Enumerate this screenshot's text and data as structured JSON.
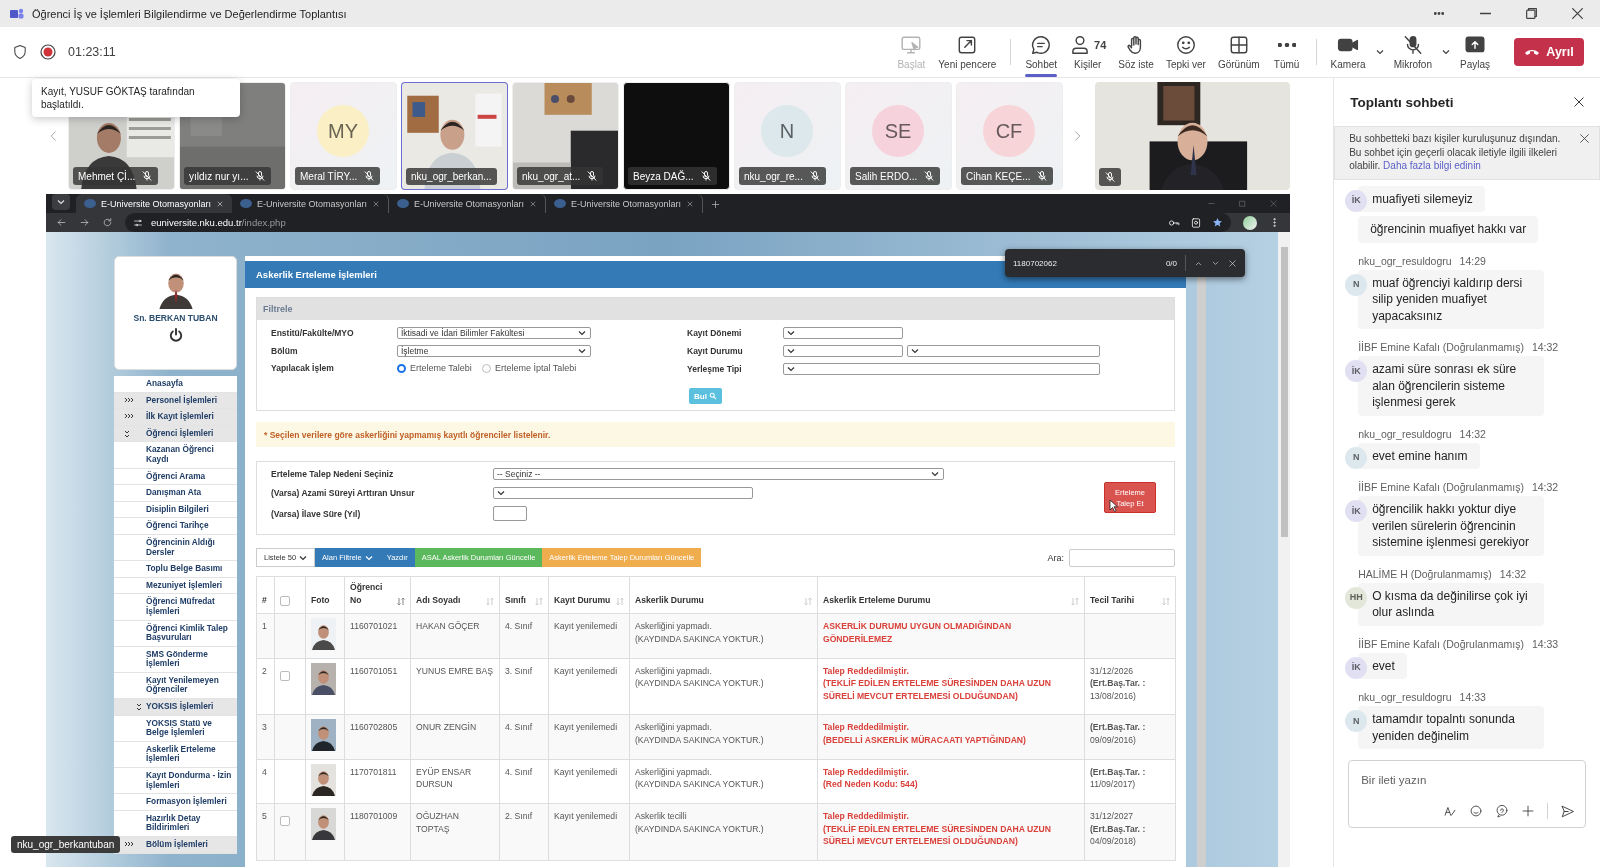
{
  "window": {
    "title": "Öğrenci İş ve İşlemleri Bilgilendirme ve Değerlendirme Toplantısı"
  },
  "meeting": {
    "recording": true,
    "timer": "01:23:11",
    "tooltip": "Kayıt, YUSUF GÖKTAŞ tarafından başlatıldı."
  },
  "toolbar": [
    {
      "label": "Başlat",
      "kind": "tray",
      "disabled": true,
      "selected": false
    },
    {
      "label": "Yeni pencere",
      "kind": "popout",
      "disabled": false,
      "selected": false
    },
    {
      "label": "Sohbet",
      "kind": "chat",
      "disabled": false,
      "selected": true
    },
    {
      "label": "Kişiler",
      "kind": "people",
      "count": "74",
      "disabled": false,
      "selected": false
    },
    {
      "label": "Söz iste",
      "kind": "hand",
      "disabled": false,
      "selected": false
    },
    {
      "label": "Tepki ver",
      "kind": "react",
      "disabled": false,
      "selected": false
    },
    {
      "label": "Görünüm",
      "kind": "view",
      "disabled": false,
      "selected": false
    },
    {
      "label": "Tümü",
      "kind": "more",
      "disabled": false,
      "selected": false
    },
    {
      "label": "Kamera",
      "kind": "camera",
      "disabled": false,
      "selected": false
    },
    {
      "label": "Mikrofon",
      "kind": "mic-off",
      "disabled": false,
      "selected": false
    },
    {
      "label": "Paylaş",
      "kind": "share",
      "disabled": false,
      "selected": false
    }
  ],
  "leave_button": "Ayrıl",
  "participants": [
    {
      "name": "Mehmet Çİ...",
      "kind": "video",
      "muted": true,
      "speaking": false
    },
    {
      "name": "yıldız nur yı...",
      "kind": "video",
      "muted": true,
      "speaking": false
    },
    {
      "name": "Meral TİRY...",
      "kind": "avatar",
      "initials": "MY",
      "color": "#fbefc5",
      "muted": true,
      "speaking": false
    },
    {
      "name": "nku_ogr_berkan...",
      "kind": "video",
      "muted": false,
      "speaking": true
    },
    {
      "name": "nku_ogr_at...",
      "kind": "video",
      "muted": true,
      "speaking": false
    },
    {
      "name": "Beyza DAĞ...",
      "kind": "blank",
      "muted": true,
      "speaking": false
    },
    {
      "name": "nku_ogr_re...",
      "kind": "avatar",
      "initials": "N",
      "color": "#dce8ec",
      "muted": true,
      "speaking": false
    },
    {
      "name": "Salih ERDO...",
      "kind": "avatar",
      "initials": "SE",
      "color": "#f6d2dc",
      "muted": true,
      "speaking": false
    },
    {
      "name": "Cihan KEÇE...",
      "kind": "avatar",
      "initials": "CF",
      "color": "#f6d4d8",
      "muted": true,
      "speaking": false
    }
  ],
  "spotlight": {
    "kind": "video",
    "muted": true
  },
  "browser": {
    "tabs": [
      {
        "title": "E-Universite Otomasyonları",
        "selected": true
      },
      {
        "title": "E-Universite Otomasyonları",
        "selected": false
      },
      {
        "title": "E-Universite Otomasyonları",
        "selected": false
      },
      {
        "title": "E-Universite Otomasyonları",
        "selected": false
      }
    ],
    "url_host": "euniversite.nku.edu.tr",
    "url_path": "/index.php",
    "find": {
      "value": "1180702062",
      "count": "0/0"
    }
  },
  "page": {
    "user": "Sn. BERKAN TUBAN",
    "menu": [
      {
        "label": "Anasayfa",
        "kind": "link"
      },
      {
        "label": "Personel İşlemleri",
        "kind": "group",
        "expanded": false
      },
      {
        "label": "İlk Kayıt İşlemleri",
        "kind": "group",
        "expanded": false
      },
      {
        "label": "Öğrenci İşlemleri",
        "kind": "group",
        "expanded": true,
        "children": [
          {
            "label": "Kazanan Öğrenci Kaydı",
            "kind": "link"
          },
          {
            "label": "Öğrenci Arama",
            "kind": "link"
          },
          {
            "label": "Danışman Ata",
            "kind": "link"
          },
          {
            "label": "Disiplin Bilgileri",
            "kind": "link"
          },
          {
            "label": "Öğrenci Tarihçe",
            "kind": "link"
          },
          {
            "label": "Öğrencinin Aldığı Dersler",
            "kind": "link"
          },
          {
            "label": "Toplu Belge Basımı",
            "kind": "link"
          },
          {
            "label": "Mezuniyet İşlemleri",
            "kind": "link"
          },
          {
            "label": "Öğrenci Müfredat İşlemleri",
            "kind": "link"
          },
          {
            "label": "Öğrenci Kimlik Talep Başvuruları",
            "kind": "link"
          },
          {
            "label": "SMS Gönderme İşlemleri",
            "kind": "link"
          },
          {
            "label": "Kayıt Yenilemeyen Öğrenciler",
            "kind": "link"
          },
          {
            "label": "YOKSIS İşlemleri",
            "kind": "group",
            "expanded": true,
            "children": [
              {
                "label": "YOKSIS Statü ve Belge İşlemleri",
                "kind": "link"
              },
              {
                "label": "Askerlik Erteleme İşlemleri",
                "kind": "link"
              },
              {
                "label": "Kayıt Dondurma - İzin İşlemleri",
                "kind": "link"
              },
              {
                "label": "Formasyon İşlemleri",
                "kind": "link"
              },
              {
                "label": "Hazırlık Detay Bildirimleri",
                "kind": "link"
              }
            ]
          }
        ]
      },
      {
        "label": "Bölüm İşlemleri",
        "kind": "group",
        "expanded": false
      }
    ],
    "title": "Askerlik Erteleme İşlemleri",
    "filter": {
      "title": "Filtrele",
      "left": [
        {
          "label": "Enstitü/Fakülte/MYO",
          "kind": "select",
          "value": "İktisadi ve İdari Bilimler Fakültesi"
        },
        {
          "label": "Bölüm",
          "kind": "select",
          "value": "İşletme"
        },
        {
          "label": "Yapılacak İşlem",
          "kind": "radio",
          "options": [
            {
              "label": "Erteleme Talebi",
              "selected": true
            },
            {
              "label": "Erteleme İptal Talebi",
              "selected": false
            }
          ]
        }
      ],
      "right": [
        {
          "label": "Kayıt Dönemi",
          "kind": "select-short"
        },
        {
          "label": "Kayıt Durumu",
          "kind": "select-pair"
        },
        {
          "label": "Yerleşme Tipi",
          "kind": "select-long"
        }
      ],
      "button": "Bul"
    },
    "notice": "* Seçilen verilere göre askerliğini yapmamış kayıtlı öğrenciler listelenir.",
    "request": {
      "fields": [
        {
          "label": "Erteleme Talep Nedeni Seçiniz",
          "kind": "select-wide",
          "value": "-- Seçiniz --"
        },
        {
          "label": "(Varsa) Azami Süreyi Arttıran Unsur",
          "kind": "select-mid"
        },
        {
          "label": "(Varsa) İlave Süre (Yıl)",
          "kind": "input"
        }
      ],
      "button": "Erteleme Talep Et"
    },
    "actions": [
      {
        "label": "Listele 50",
        "caret": true
      },
      {
        "label": "Alan Filtrele",
        "caret": true
      },
      {
        "label": "Yazdır",
        "caret": false
      },
      {
        "label": "ASAL Askerlik Durumları Güncelle",
        "caret": false
      },
      {
        "label": "Askerlik Erteleme Talep Durumları Güncelle",
        "caret": false
      }
    ],
    "search_label": "Ara:",
    "columns": [
      {
        "label": "#",
        "kind": "text",
        "sortable": false
      },
      {
        "kind": "check",
        "checked": false
      },
      {
        "label": "Foto",
        "kind": "text",
        "sortable": false
      },
      {
        "label": "Öğrenci No",
        "kind": "text",
        "sortable": true,
        "sorted": true
      },
      {
        "label": "Adı Soyadı",
        "kind": "text",
        "sortable": true,
        "sorted": false
      },
      {
        "label": "Sınıfı",
        "kind": "text",
        "sortable": true,
        "sorted": false
      },
      {
        "label": "Kayıt Durumu",
        "kind": "text",
        "sortable": true,
        "sorted": false
      },
      {
        "label": "Askerlik Durumu",
        "kind": "text",
        "sortable": true,
        "sorted": false
      },
      {
        "label": "Askerlik Erteleme Durumu",
        "kind": "text",
        "sortable": true,
        "sorted": false
      },
      {
        "label": "Tecil Tarihi",
        "kind": "text",
        "sortable": true,
        "sorted": false
      }
    ],
    "rows": [
      {
        "no": "1",
        "selectable": false,
        "student_no": "1160701021",
        "name": "HAKAN GÖÇER",
        "grade": "4. Sınıf",
        "status": "Kayıt yenilemedi",
        "military": [
          "Askerliğini yapmadı.",
          "(KAYDINDA SAKINCA YOKTUR.)"
        ],
        "deferment": [
          "ASKERLİK DURUMU UYGUN OLMADIĞINDAN GÖNDERİLEMEZ"
        ]
      },
      {
        "no": "2",
        "selectable": true,
        "checked": false,
        "student_no": "1160701051",
        "name": "YUNUS EMRE BAŞ",
        "grade": "3. Sınıf",
        "status": "Kayıt yenilemedi",
        "military": [
          "Askerliğini yapmadı.",
          "(KAYDINDA SAKINCA YOKTUR.)"
        ],
        "deferment": [
          "Talep Reddedilmiştir.",
          "(TEKLİF EDİLEN ERTELEME SÜRESİNDEN DAHA UZUN SÜRELİ MEVCUT ERTELEMESİ OLDUĞUNDAN)"
        ],
        "tecil": [
          "31/12/2026",
          "**(Ert.Baş.Tar. :** 13/08/2016)"
        ]
      },
      {
        "no": "3",
        "selectable": false,
        "student_no": "1160702805",
        "name": "ONUR ZENGİN",
        "grade": "4. Sınıf",
        "status": "Kayıt yenilemedi",
        "military": [
          "Askerliğini yapmadı.",
          "(KAYDINDA SAKINCA YOKTUR.)"
        ],
        "deferment": [
          "Talep Reddedilmiştir.",
          "(BEDELLİ ASKERLİK MÜRACAATI YAPTIĞINDAN)"
        ],
        "tecil": [
          "**(Ert.Baş.Tar. :** 09/09/2016)"
        ]
      },
      {
        "no": "4",
        "selectable": false,
        "student_no": "1170701811",
        "name": "EYÜP ENSAR DURSUN",
        "grade": "4. Sınıf",
        "status": "Kayıt yenilemedi",
        "military": [
          "Askerliğini yapmadı.",
          "(KAYDINDA SAKINCA YOKTUR.)"
        ],
        "deferment": [
          "Talep Reddedilmiştir.",
          "(Red Neden Kodu: 544)"
        ],
        "tecil": [
          "**(Ert.Baş.Tar. :** 11/09/2017)"
        ]
      },
      {
        "no": "5",
        "selectable": true,
        "checked": false,
        "student_no": "1180701009",
        "name": "OĞUZHAN TOPTAŞ",
        "grade": "2. Sınıf",
        "status": "Kayıt yenilemedi",
        "military": [
          "Askerlik tecilli",
          "(KAYDINDA SAKINCA YOKTUR.)"
        ],
        "deferment": [
          "Talep Reddedilmiştir.",
          "(TEKLİF EDİLEN ERTELEME SÜRESİNDEN DAHA UZUN SÜRELİ MEVCUT ERTELEMESİ OLDUĞUNDAN)"
        ],
        "tecil": [
          "31/12/2027",
          "**(Ert.Baş.Tar. :** 04/09/2018)"
        ]
      }
    ]
  },
  "presenter_label": "nku_ogr_berkantuban",
  "chat": {
    "title": "Toplantı sohbeti",
    "notice": "Bu sohbetteki bazı kişiler kuruluşunuz dışından. Bu sohbet için geçerli olacak iletiyle ilgili ilkeleri olabilir.",
    "notice_link": "Daha fazla bilgi edinin",
    "groups": [
      {
        "initials": "İK",
        "color": "#e1dff2",
        "messages": [
          "muafiyeti silemeyiz",
          "öğrencinin muafiyet hakkı var"
        ]
      },
      {
        "sender": "nku_ogr_resuldogru",
        "time": "14:29",
        "initials": "N",
        "color": "#dce8ee",
        "messages": [
          "muaf öğrenciyi kaldırıp dersi silip yeniden muafiyet yapacaksınız"
        ]
      },
      {
        "sender": "İİBF Emine Kafalı (Doğrulanmamış)",
        "time": "14:32",
        "initials": "İK",
        "color": "#e1dff2",
        "messages": [
          "azami süre sonrası ek süre alan öğrencilerin sisteme işlenmesi gerek"
        ]
      },
      {
        "sender": "nku_ogr_resuldogru",
        "time": "14:32",
        "initials": "N",
        "color": "#dce8ee",
        "messages": [
          "evet emine hanım"
        ]
      },
      {
        "sender": "İİBF Emine Kafalı (Doğrulanmamış)",
        "time": "14:32",
        "initials": "İK",
        "color": "#e1dff2",
        "messages": [
          "öğrencilik hakkı yoktur diye verilen sürelerin öğrencinin sistemine işlenmesi gerekiyor"
        ]
      },
      {
        "sender": "HALİME H (Doğrulanmamış)",
        "time": "14:32",
        "initials": "HH",
        "color": "#e3e7d9",
        "messages": [
          "O kısma da değinilirse çok iyi olur aslında"
        ]
      },
      {
        "sender": "İİBF Emine Kafalı (Doğrulanmamış)",
        "time": "14:33",
        "initials": "İK",
        "color": "#e1dff2",
        "messages": [
          "evet"
        ]
      },
      {
        "sender": "nku_ogr_resuldogru",
        "time": "14:33",
        "initials": "N",
        "color": "#dce8ee",
        "messages": [
          "tamamdır topalntı sonunda yeniden değinelim"
        ]
      }
    ],
    "composer": {
      "placeholder": "Bir ileti yazın"
    }
  }
}
